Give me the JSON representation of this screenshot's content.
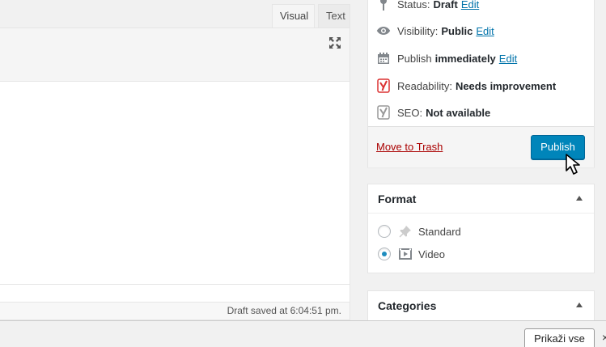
{
  "editor": {
    "tabs": [
      {
        "label": "Visual"
      },
      {
        "label": "Text"
      }
    ],
    "status": "Draft saved at 6:04:51 pm."
  },
  "publish": {
    "status_label": "Status:",
    "status_value": "Draft",
    "status_edit": "Edit",
    "visibility_label": "Visibility:",
    "visibility_value": "Public",
    "visibility_edit": "Edit",
    "publish_label": "Publish",
    "publish_value": "immediately",
    "publish_edit": "Edit",
    "readability_label": "Readability:",
    "readability_value": "Needs improvement",
    "seo_label": "SEO:",
    "seo_value": "Not available",
    "trash_label": "Move to Trash",
    "publish_button": "Publish"
  },
  "format": {
    "title": "Format",
    "options": [
      {
        "label": "Standard",
        "checked": false
      },
      {
        "label": "Video",
        "checked": true
      }
    ]
  },
  "categories": {
    "title": "Categories"
  },
  "bottom_bar": {
    "show_all": "Prikaži vse",
    "close": "×"
  },
  "colors": {
    "accent": "#0085ba",
    "link": "#0073aa",
    "trash": "#a00000",
    "yoast_red": "#dc3232"
  }
}
